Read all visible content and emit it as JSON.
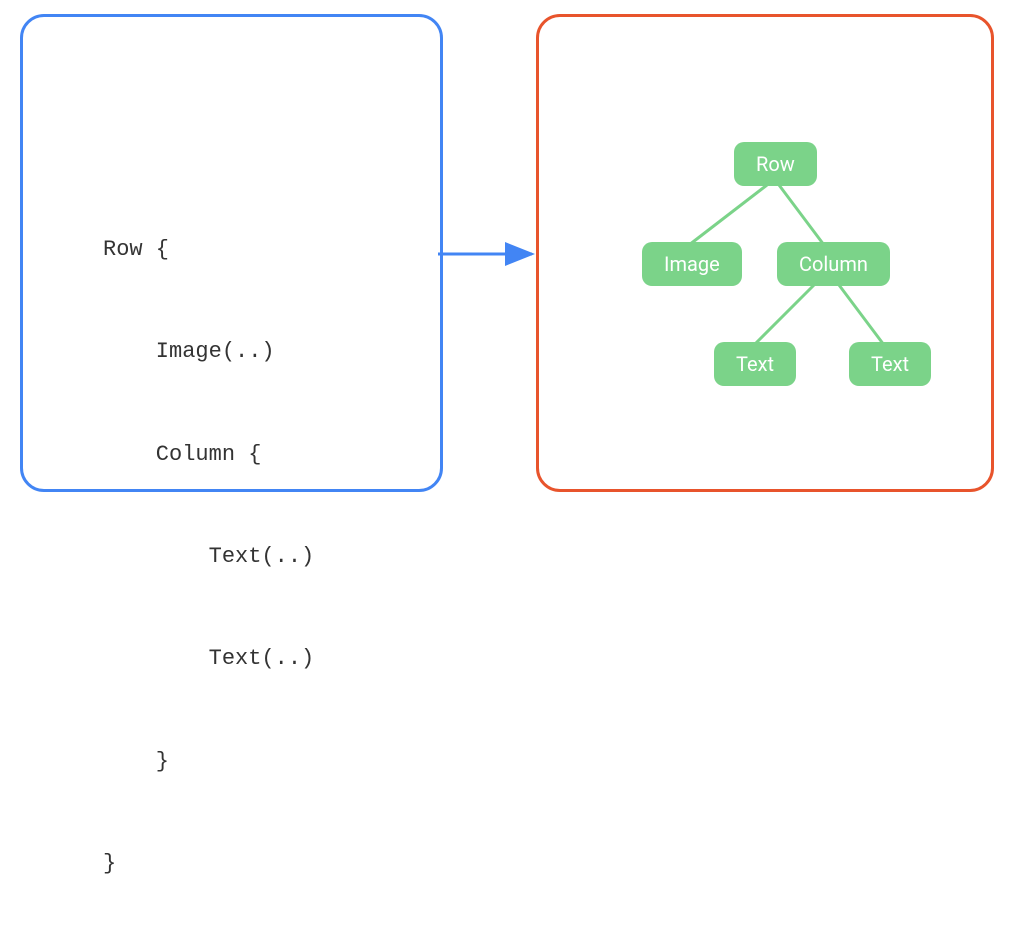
{
  "code": {
    "lines": [
      "Row {",
      "    Image(..)",
      "    Column {",
      "        Text(..)",
      "        Text(..)",
      "    }",
      "}"
    ]
  },
  "tree": {
    "row": "Row",
    "image": "Image",
    "column": "Column",
    "text1": "Text",
    "text2": "Text"
  },
  "colors": {
    "left_border": "#4285F4",
    "right_border": "#E8542C",
    "node_fill": "#7BD389",
    "edge": "#7BD389",
    "arrow": "#4285F4"
  }
}
